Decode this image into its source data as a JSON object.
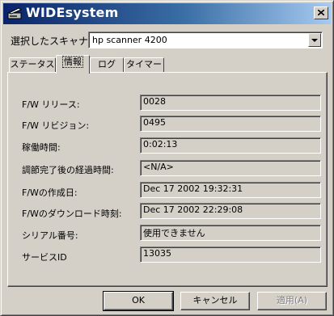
{
  "window": {
    "title": "WIDEsystem",
    "icons": {
      "app": "scanner-app-icon",
      "close": "close-icon"
    }
  },
  "scanner": {
    "label": "選択したスキャナ",
    "value": "hp scanner 4200",
    "dropdown_icon": "chevron-down-icon"
  },
  "tabs": [
    {
      "label": "ステータス",
      "active": false
    },
    {
      "label": "情報",
      "active": true
    },
    {
      "label": "ログ",
      "active": false
    },
    {
      "label": "タイマー",
      "active": false
    }
  ],
  "fields": [
    {
      "label": "F/W リリース:",
      "value": "0028"
    },
    {
      "label": "F/W リビジョン:",
      "value": "0495"
    },
    {
      "label": "稼働時間:",
      "value": "0:02:13"
    },
    {
      "label": "調節完了後の経過時間:",
      "value": "<N/A>"
    },
    {
      "label": "F/Wの作成日:",
      "value": "Dec 17 2002 19:32:31"
    },
    {
      "label": "F/Wのダウンロード時刻:",
      "value": "Dec 17 2002 22:29:08"
    },
    {
      "label": "シリアル番号:",
      "value": "使用できません"
    },
    {
      "label": "サービスID",
      "value": "13035"
    }
  ],
  "buttons": {
    "ok": "OK",
    "cancel": "キャンセル",
    "apply": "適用(A)"
  }
}
